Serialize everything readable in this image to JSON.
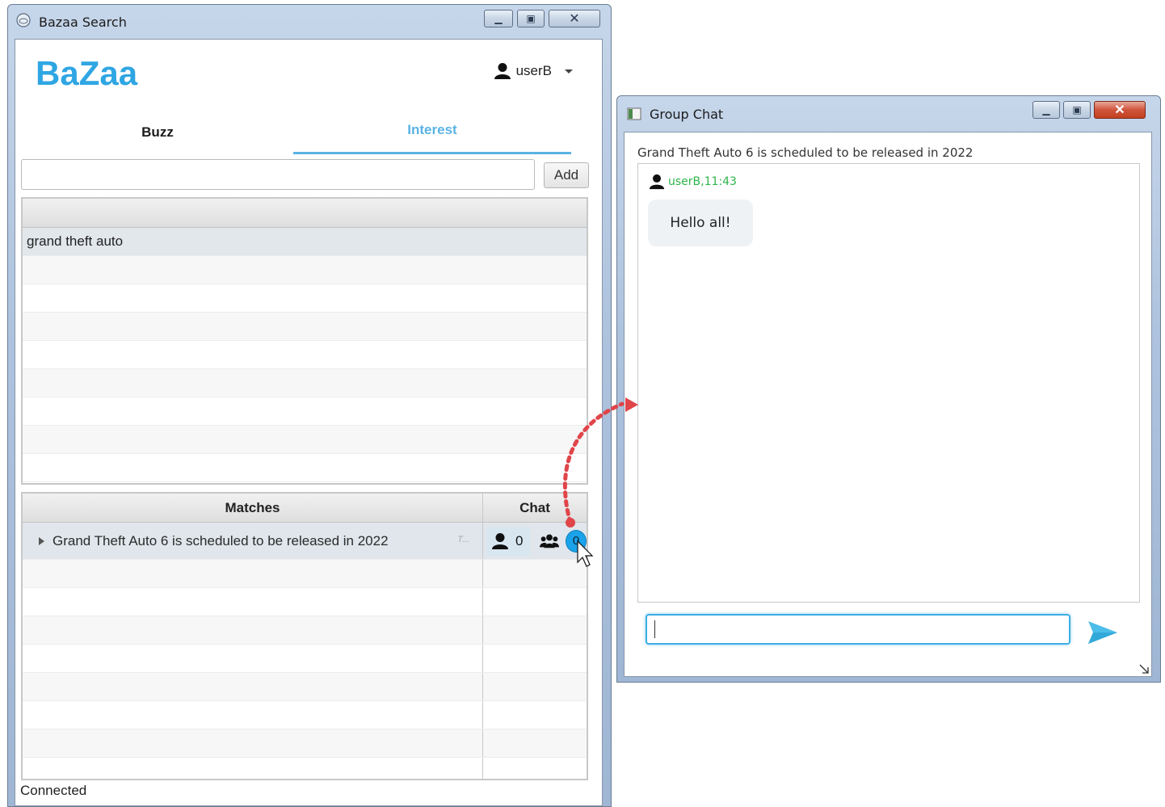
{
  "bazaa_window": {
    "title": "Bazaa Search",
    "logo": "BaZaa",
    "user": "userB",
    "tabs": [
      {
        "label": "Buzz",
        "active": false
      },
      {
        "label": "Interest",
        "active": true
      }
    ],
    "interest_input": {
      "value": "",
      "placeholder": ""
    },
    "add_button": "Add",
    "interests": [
      "grand theft auto",
      "",
      "",
      "",
      "",
      "",
      "",
      "",
      ""
    ],
    "matches_table": {
      "headers": {
        "matches": "Matches",
        "chat": "Chat"
      },
      "rows": [
        {
          "text": "Grand Theft Auto 6 is scheduled to be released in 2022",
          "truncated": "T...",
          "single_count": "0",
          "group_count": "0"
        }
      ],
      "empty_rows": 8
    },
    "status": "Connected"
  },
  "group_chat_window": {
    "title": "Group Chat",
    "topic": "Grand Theft Auto 6 is scheduled to be released in 2022",
    "messages": [
      {
        "sender": "userB,11:43",
        "text": "Hello all!"
      }
    ],
    "input": {
      "value": "",
      "placeholder": ""
    }
  },
  "colors": {
    "brand": "#2fa6e3",
    "active_tab": "#5ab3e4",
    "sender": "#2fb54a",
    "badge": "#1aa3ea",
    "annotation_arrow": "#e0454a"
  },
  "icons": {
    "user": "user-icon",
    "group": "group-icon",
    "send": "send-icon",
    "menu": "chevron-down-icon"
  }
}
